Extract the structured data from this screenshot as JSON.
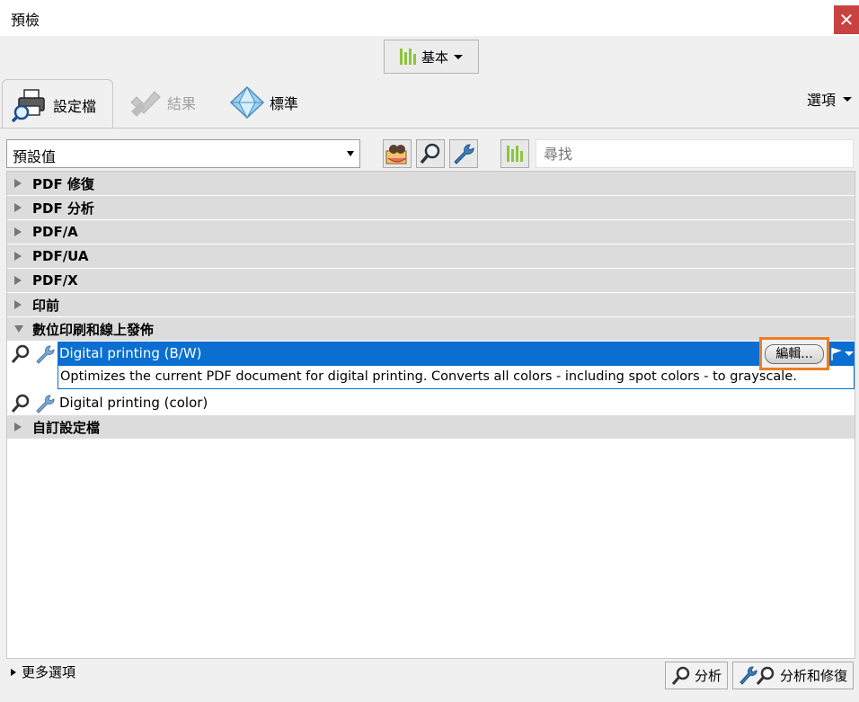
{
  "window": {
    "title": "預檢",
    "close_glyph": "✕"
  },
  "mode": {
    "label": "基本",
    "icon": "bars-chart-icon"
  },
  "tabs": [
    {
      "label": "設定檔",
      "icon": "printer-magnifier-icon",
      "active": true
    },
    {
      "label": "結果",
      "icon": "results-icon",
      "active": false
    },
    {
      "label": "標準",
      "icon": "diamond-icon",
      "active": false
    }
  ],
  "options_menu": {
    "label": "選項"
  },
  "toolbar": {
    "preset_value": "預設值",
    "search_placeholder": "尋找"
  },
  "groups": [
    {
      "label": "PDF 修復",
      "expanded": false
    },
    {
      "label": "PDF 分析",
      "expanded": false
    },
    {
      "label": "PDF/A",
      "expanded": false
    },
    {
      "label": "PDF/UA",
      "expanded": false
    },
    {
      "label": "PDF/X",
      "expanded": false
    },
    {
      "label": "印前",
      "expanded": false
    },
    {
      "label": "數位印刷和線上發佈",
      "expanded": true,
      "profiles": [
        {
          "name": "Digital printing (B/W)",
          "selected": true,
          "description": "Optimizes the current PDF document for digital printing. Converts all colors - including spot colors - to grayscale.",
          "edit_label": "編輯..."
        },
        {
          "name": "Digital printing (color)",
          "selected": false
        }
      ]
    },
    {
      "label": "自訂設定檔",
      "expanded": false
    }
  ],
  "footer": {
    "more_options": "更多選項",
    "analyze": "分析",
    "analyze_fix": "分析和修復"
  },
  "colors": {
    "selection": "#0a6fd1",
    "highlight": "#ee7d23",
    "bars": "#8dc53e"
  }
}
